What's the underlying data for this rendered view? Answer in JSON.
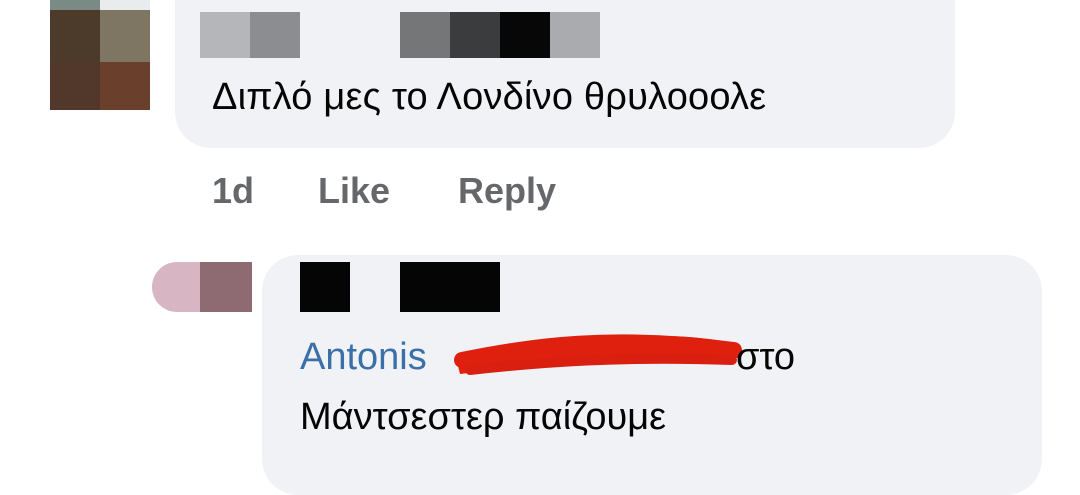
{
  "comment1": {
    "text": "Διπλό μες το Λονδίνο θρυλοοολε",
    "actions": {
      "time": "1d",
      "like": "Like",
      "reply": "Reply"
    }
  },
  "reply1": {
    "author": "Antonis",
    "text_line1": "στο",
    "text_line2": "Μάντσεστερ παίζουμε"
  },
  "colors": {
    "bubble": "#f0f2f5",
    "author_link": "#3a6fa8",
    "action_text": "#65676b",
    "redaction": "#e0200f"
  }
}
